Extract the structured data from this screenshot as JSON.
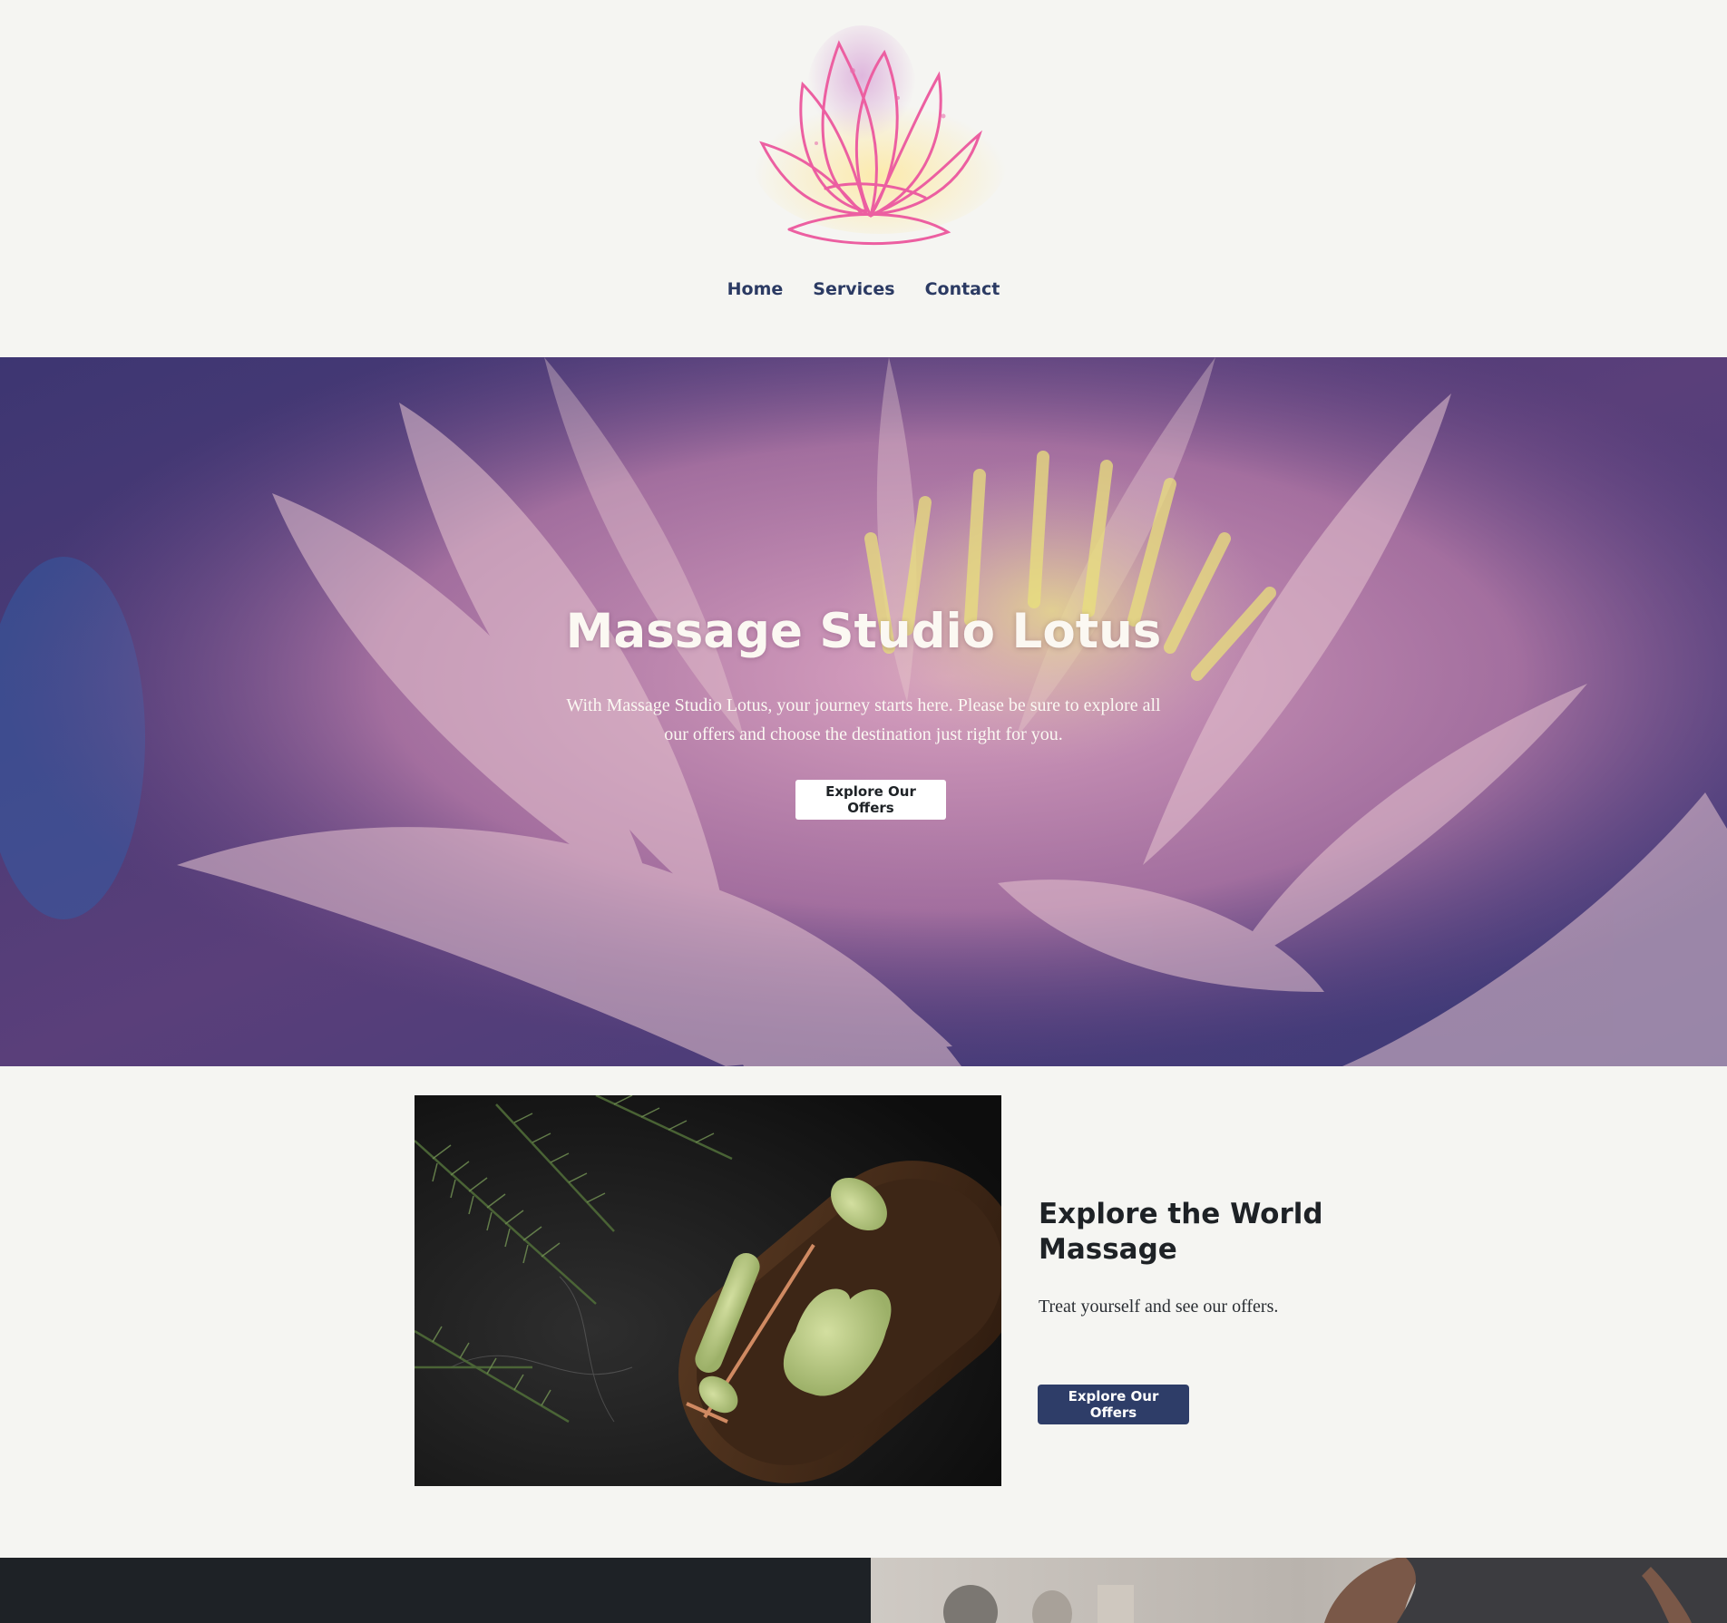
{
  "header": {
    "logo_icon": "lotus-logo-icon",
    "nav": [
      {
        "label": "Home"
      },
      {
        "label": "Services"
      },
      {
        "label": "Contact"
      }
    ],
    "nav_color": "#2b3a63"
  },
  "hero": {
    "title": "Massage Studio Lotus",
    "text_line1": "With Massage Studio Lotus, your journey starts here. Please be sure to explore all",
    "text_line2": "our offers and choose the destination just right for you.",
    "button_label": "Explore Our Offers",
    "image": "lotus-flower-photo"
  },
  "feature": {
    "title_line1": "Explore the World",
    "title_line2": "Massage",
    "text": "Treat yourself and see our offers.",
    "button_label": "Explore Our Offers",
    "button_color": "#2e3d68",
    "image": "jade-roller-gua-sha-photo"
  },
  "colors": {
    "page_bg": "#f5f5f2",
    "dark_band": "#1e2226"
  }
}
